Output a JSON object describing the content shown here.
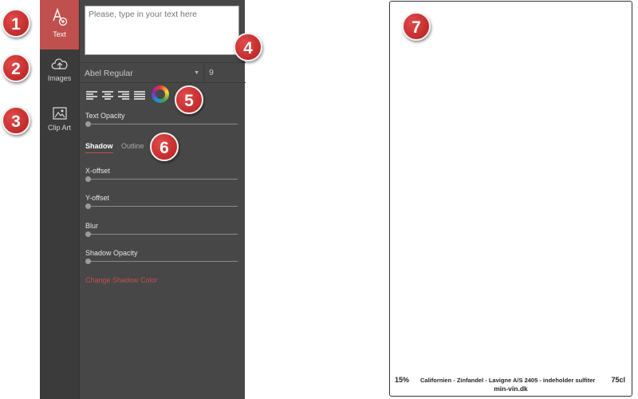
{
  "sidebar": {
    "items": [
      {
        "label": "Text",
        "icon": "text-icon",
        "active": true
      },
      {
        "label": "Images",
        "icon": "cloud-upload-icon",
        "active": false
      },
      {
        "label": "Clip Art",
        "icon": "clip-art-icon",
        "active": false
      }
    ]
  },
  "text_panel": {
    "text_placeholder": "Please, type in your text here",
    "font_name": "Abel Regular",
    "font_size": "9",
    "text_opacity_label": "Text Opacity",
    "tabs": [
      "Shadow",
      "Outline"
    ],
    "active_tab": "Shadow",
    "sliders": [
      {
        "label": "X-offset",
        "value": 0
      },
      {
        "label": "Y-offset",
        "value": 0
      },
      {
        "label": "Blur",
        "value": 0
      },
      {
        "label": "Shadow Opacity",
        "value": 0
      }
    ],
    "change_shadow_color": "Change Shadow Color"
  },
  "callouts": [
    "1",
    "2",
    "3",
    "4",
    "5",
    "6",
    "7"
  ],
  "label_canvas": {
    "alcohol": "15%",
    "description": "Californien - Zinfandel - Lavigne A/S 2405 - indeholder sulfiter",
    "volume": "75cl",
    "website": "min-vin.dk"
  },
  "colors": {
    "accent": "#c0504d",
    "rail_bg": "#3b3b3b",
    "panel_bg": "#474747",
    "badge": "#c62828"
  }
}
